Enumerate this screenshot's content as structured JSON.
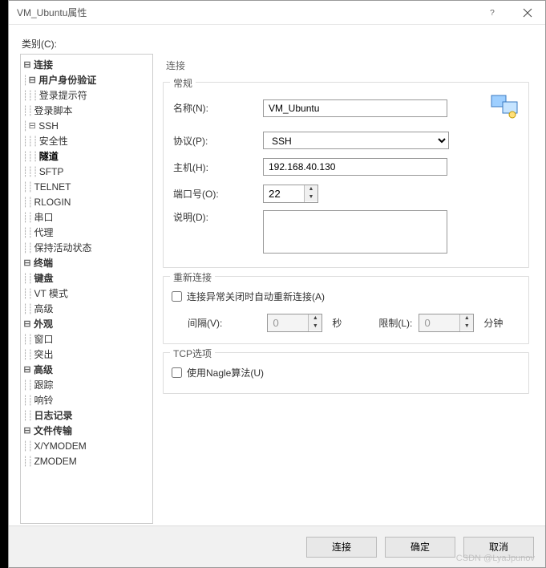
{
  "window": {
    "title": "VM_Ubuntu属性",
    "help": "?",
    "close": "×"
  },
  "category_label": "类别(C):",
  "tree": {
    "connection": "连接",
    "user_auth": "用户身份验证",
    "login_prompt": "登录提示符",
    "login_script": "登录脚本",
    "ssh": "SSH",
    "security": "安全性",
    "tunnel": "隧道",
    "sftp": "SFTP",
    "telnet": "TELNET",
    "rlogin": "RLOGIN",
    "serial": "串口",
    "proxy": "代理",
    "keepalive": "保持活动状态",
    "terminal": "终端",
    "keyboard": "键盘",
    "vt_mode": "VT 模式",
    "advanced_term": "高级",
    "appearance": "外观",
    "window": "窗口",
    "highlight": "突出",
    "advanced": "高级",
    "trace": "跟踪",
    "bell": "响铃",
    "logging": "日志记录",
    "file_transfer": "文件传输",
    "xymodem": "X/YMODEM",
    "zmodem": "ZMODEM"
  },
  "panel": {
    "title": "连接",
    "general": {
      "legend": "常规",
      "name_label": "名称(N):",
      "name_value": "VM_Ubuntu",
      "protocol_label": "协议(P):",
      "protocol_value": "SSH",
      "host_label": "主机(H):",
      "host_value": "192.168.40.130",
      "port_label": "端口号(O):",
      "port_value": "22",
      "desc_label": "说明(D):",
      "desc_value": ""
    },
    "reconnect": {
      "legend": "重新连接",
      "auto_label": "连接异常关闭时自动重新连接(A)",
      "interval_label": "间隔(V):",
      "interval_value": "0",
      "interval_unit": "秒",
      "limit_label": "限制(L):",
      "limit_value": "0",
      "limit_unit": "分钟"
    },
    "tcp": {
      "legend": "TCP选项",
      "nagle_label": "使用Nagle算法(U)"
    }
  },
  "footer": {
    "connect": "连接",
    "ok": "确定",
    "cancel": "取消"
  },
  "watermark": "CSDN @LyaJpunov"
}
